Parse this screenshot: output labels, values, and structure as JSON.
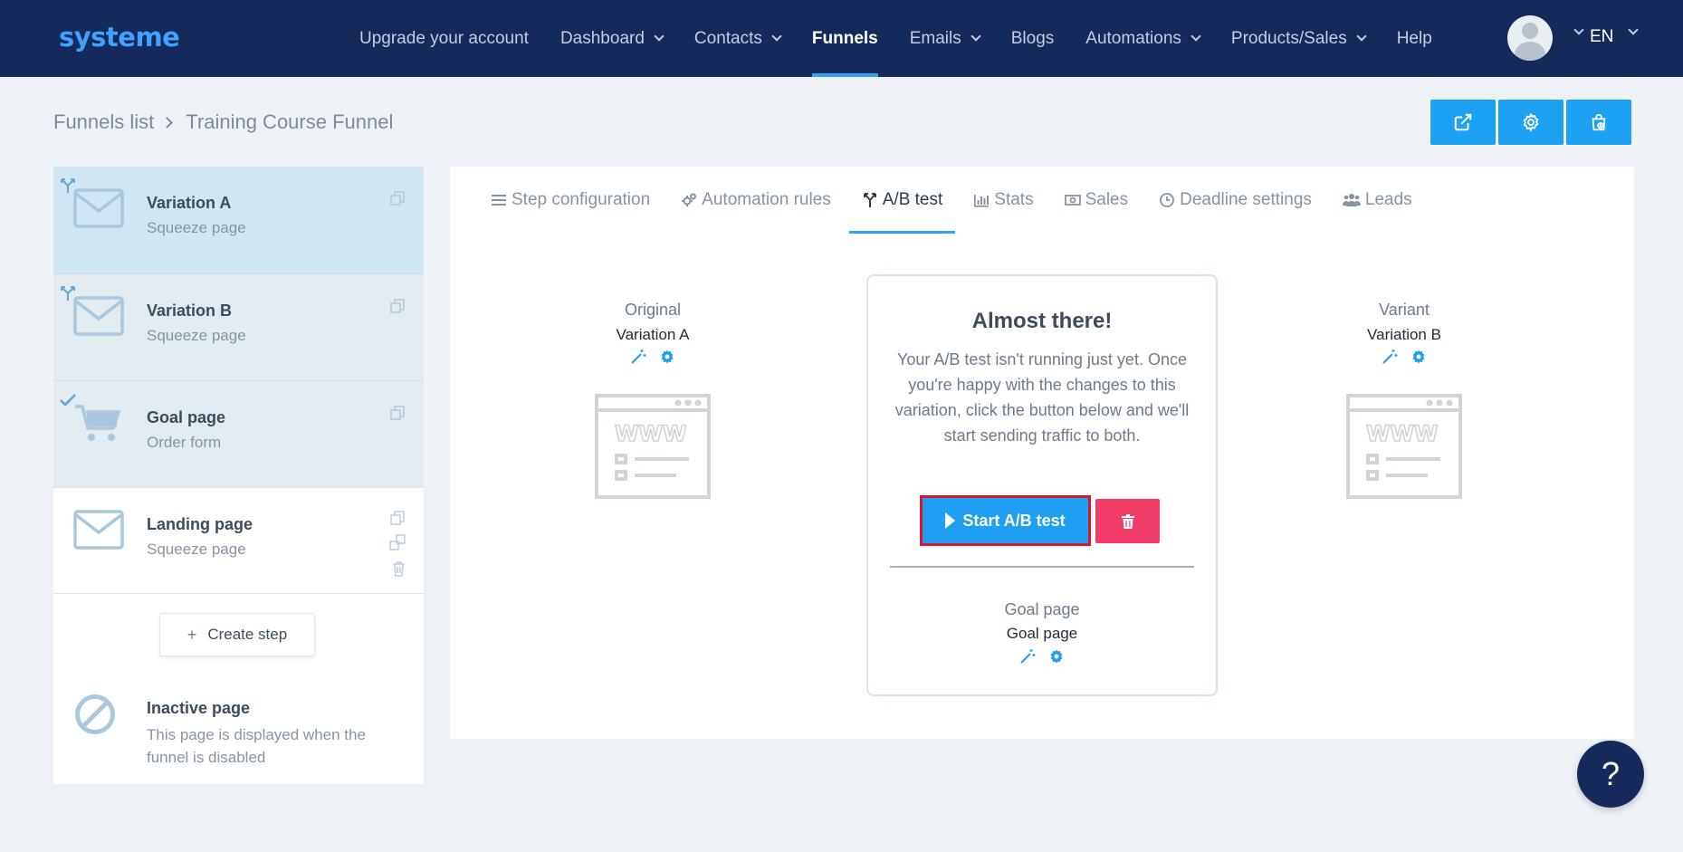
{
  "header": {
    "logo": "systeme",
    "nav": [
      {
        "label": "Upgrade your account",
        "dropdown": false,
        "active": false
      },
      {
        "label": "Dashboard",
        "dropdown": true,
        "active": false
      },
      {
        "label": "Contacts",
        "dropdown": true,
        "active": false
      },
      {
        "label": "Funnels",
        "dropdown": false,
        "active": true
      },
      {
        "label": "Emails",
        "dropdown": true,
        "active": false
      },
      {
        "label": "Blogs",
        "dropdown": false,
        "active": false
      },
      {
        "label": "Automations",
        "dropdown": true,
        "active": false
      },
      {
        "label": "Products/Sales",
        "dropdown": true,
        "active": false
      },
      {
        "label": "Help",
        "dropdown": false,
        "active": false
      }
    ],
    "language": "EN"
  },
  "breadcrumb": {
    "root": "Funnels list",
    "current": "Training Course Funnel"
  },
  "top_actions": [
    "external-link-icon",
    "gear-icon",
    "shopping-bag-icon"
  ],
  "sidebar": {
    "steps": [
      {
        "title": "Variation A",
        "subtitle": "Squeeze page",
        "icon": "envelope-icon",
        "badge": "split-icon"
      },
      {
        "title": "Variation B",
        "subtitle": "Squeeze page",
        "icon": "envelope-icon",
        "badge": "split-icon"
      },
      {
        "title": "Goal page",
        "subtitle": "Order form",
        "icon": "cart-icon",
        "badge": "check-icon"
      },
      {
        "title": "Landing page",
        "subtitle": "Squeeze page",
        "icon": "envelope-icon"
      }
    ],
    "create_step": "Create step",
    "inactive": {
      "title": "Inactive page",
      "description": "This page is displayed when the funnel is disabled"
    }
  },
  "tabs": [
    {
      "label": "Step configuration",
      "icon": "list-icon",
      "active": false
    },
    {
      "label": "Automation rules",
      "icon": "gears-icon",
      "active": false
    },
    {
      "label": "A/B test",
      "icon": "split-icon",
      "active": true
    },
    {
      "label": "Stats",
      "icon": "bar-chart-icon",
      "active": false
    },
    {
      "label": "Sales",
      "icon": "money-icon",
      "active": false
    },
    {
      "label": "Deadline settings",
      "icon": "clock-icon",
      "active": false
    },
    {
      "label": "Leads",
      "icon": "users-icon",
      "active": false
    }
  ],
  "ab_test": {
    "original": {
      "label": "Original",
      "name": "Variation A"
    },
    "variant": {
      "label": "Variant",
      "name": "Variation B"
    },
    "card": {
      "title": "Almost there!",
      "text": "Your A/B test isn't running just yet. Once you're happy with the changes to this variation, click the button below and we'll start sending traffic to both.",
      "start_button": "Start A/B test",
      "goal_label": "Goal page",
      "goal_name": "Goal page"
    }
  },
  "help": "?",
  "colors": {
    "header_bg": "#15295a",
    "accent": "#1da1f2",
    "danger": "#f23d6a",
    "highlight": "#d9162b"
  }
}
